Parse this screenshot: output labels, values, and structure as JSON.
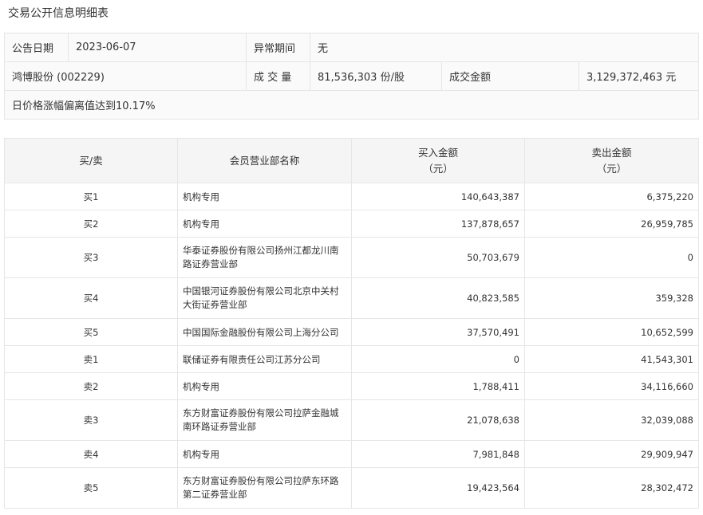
{
  "title": "交易公开信息明细表",
  "info": {
    "date_label": "公告日期",
    "date_value": "2023-06-07",
    "abnormal_label": "异常期间",
    "abnormal_value": "无",
    "stock": "鸿博股份 (002229)",
    "volume_label": "成 交 量",
    "volume_value": "81,536,303 份/股",
    "amount_label": "成交金额",
    "amount_value": "3,129,372,463 元",
    "note": "日价格涨幅偏离值达到10.17%"
  },
  "headers": {
    "side": "买/卖",
    "dept": "会员营业部名称",
    "buy": "买入金额",
    "buy_unit": "（元）",
    "sell": "卖出金额",
    "sell_unit": "（元）"
  },
  "rows": [
    {
      "side": "买1",
      "name": "机构专用",
      "buy": "140,643,387",
      "sell": "6,375,220"
    },
    {
      "side": "买2",
      "name": "机构专用",
      "buy": "137,878,657",
      "sell": "26,959,785"
    },
    {
      "side": "买3",
      "name": "华泰证券股份有限公司扬州江都龙川南",
      "name2": "路证券营业部",
      "buy": "50,703,679",
      "sell": "0"
    },
    {
      "side": "买4",
      "name": "中国银河证券股份有限公司北京中关村",
      "name2": "大街证券营业部",
      "buy": "40,823,585",
      "sell": "359,328"
    },
    {
      "side": "买5",
      "name": "中国国际金融股份有限公司上海分公司",
      "buy": "37,570,491",
      "sell": "10,652,599"
    },
    {
      "side": "卖1",
      "name": "联储证券有限责任公司江苏分公司",
      "buy": "0",
      "sell": "41,543,301"
    },
    {
      "side": "卖2",
      "name": "机构专用",
      "buy": "1,788,411",
      "sell": "34,116,660"
    },
    {
      "side": "卖3",
      "name": "东方财富证券股份有限公司拉萨金融城",
      "name2": "南环路证券营业部",
      "buy": "21,078,638",
      "sell": "32,039,088"
    },
    {
      "side": "卖4",
      "name": "机构专用",
      "buy": "7,981,848",
      "sell": "29,909,947"
    },
    {
      "side": "卖5",
      "name": "东方财富证券股份有限公司拉萨东环路",
      "name2": "第二证券营业部",
      "buy": "19,423,564",
      "sell": "28,302,472"
    }
  ]
}
